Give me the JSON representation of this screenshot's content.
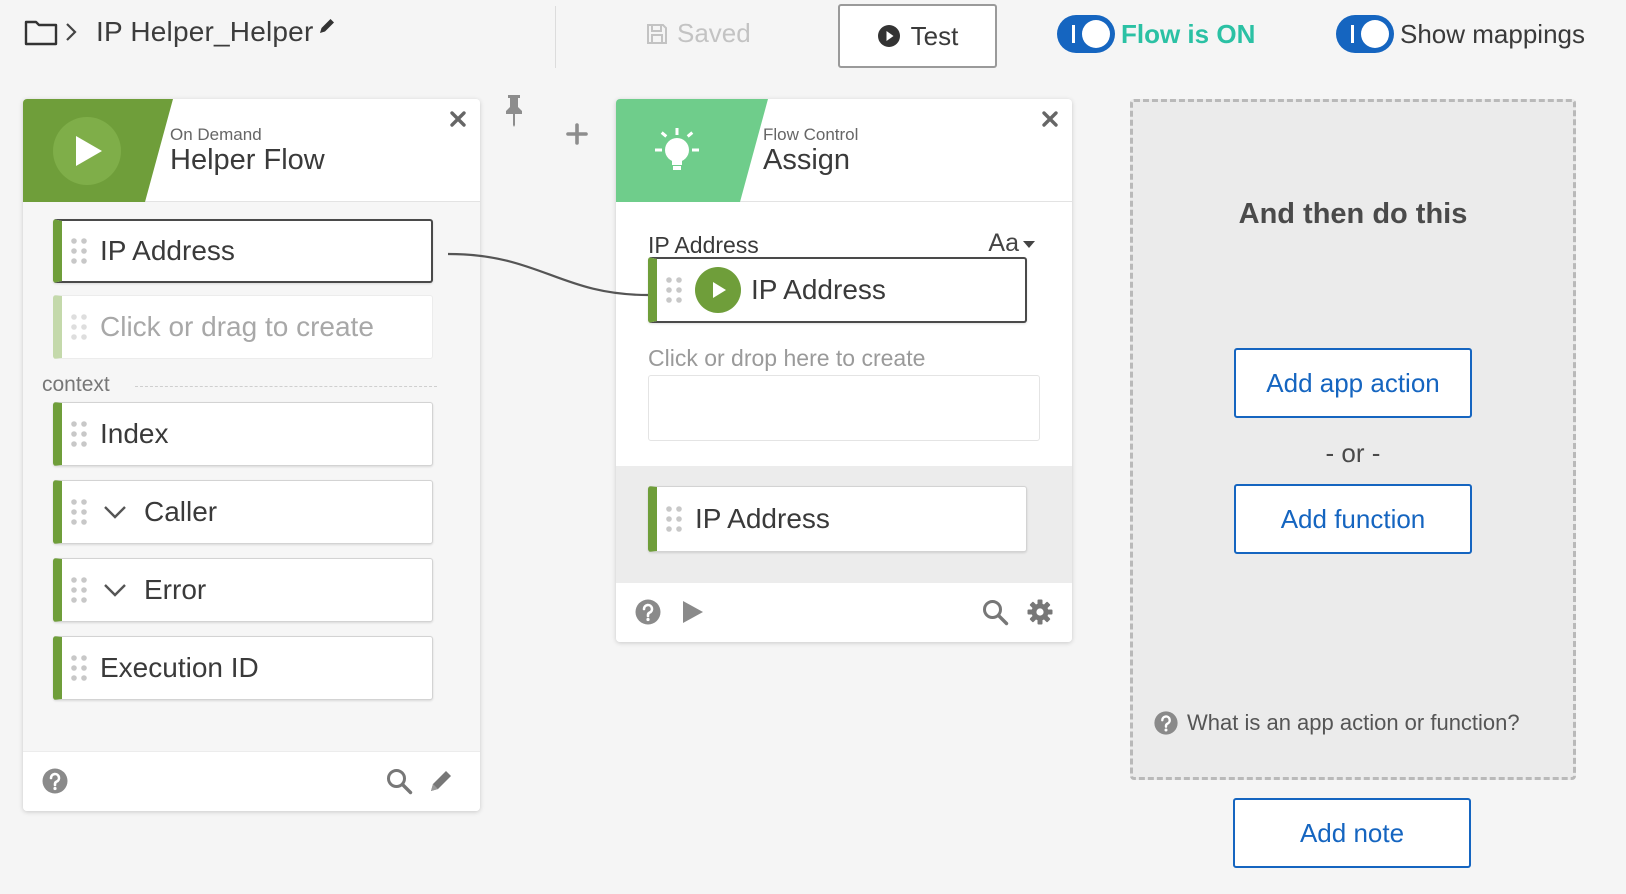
{
  "header": {
    "flow_title": "IP Helper_Helper",
    "saved_label": "Saved",
    "test_label": "Test",
    "flow_status_label": "Flow is ON",
    "show_mappings_label": "Show mappings"
  },
  "trigger_card": {
    "subtitle": "On Demand",
    "title": "Helper Flow",
    "fields": {
      "ip_address": "IP Address",
      "create_placeholder": "Click or drag to create",
      "context_label": "context",
      "index": "Index",
      "caller": "Caller",
      "error": "Error",
      "execution_id": "Execution ID"
    }
  },
  "assign_card": {
    "subtitle": "Flow Control",
    "title": "Assign",
    "input_label": "IP Address",
    "type_selector": "Aa",
    "mapped_field": "IP Address",
    "drop_hint": "Click or drop here to create",
    "output_field": "IP Address"
  },
  "next_step": {
    "title": "And then do this",
    "add_app_action": "Add app action",
    "or_label": "- or -",
    "add_function": "Add function",
    "help_text": "What is an app action or function?"
  },
  "add_note_label": "Add note",
  "colors": {
    "trigger_green": "#6f9e3a",
    "assign_green": "#6fcd8b",
    "toggle_blue": "#1565c0",
    "flow_on_teal": "#2bc1a4"
  }
}
